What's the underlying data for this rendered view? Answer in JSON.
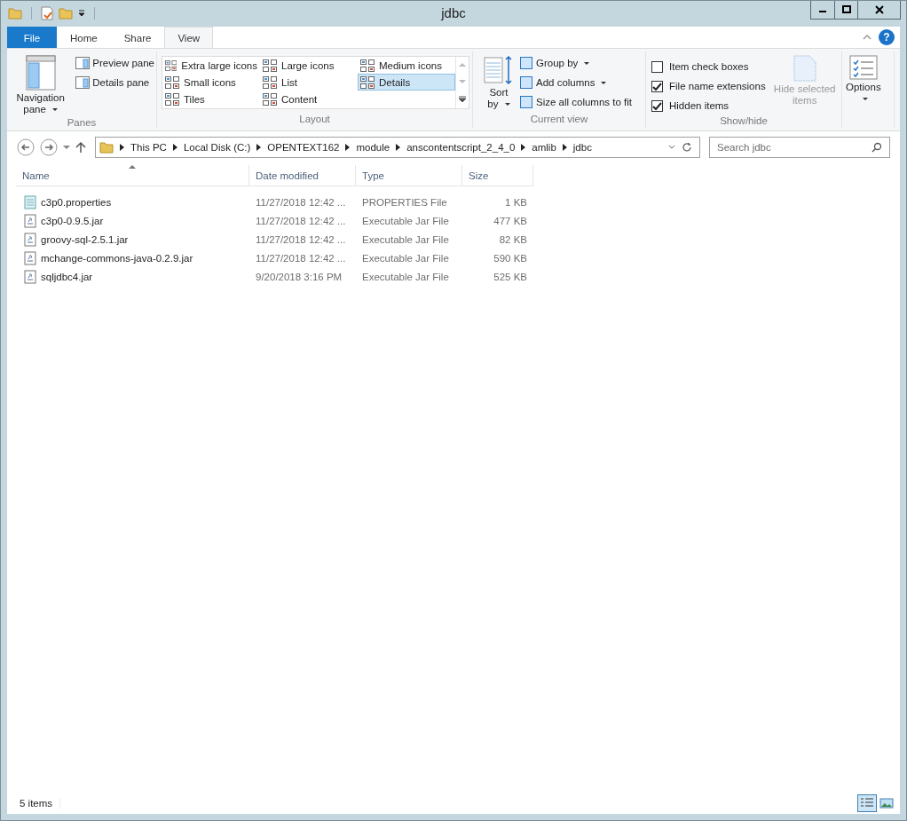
{
  "window": {
    "title": "jdbc",
    "help": "?"
  },
  "tabs": [
    {
      "label": "File",
      "kind": "file",
      "selected": false
    },
    {
      "label": "Home",
      "kind": "normal",
      "selected": false
    },
    {
      "label": "Share",
      "kind": "normal",
      "selected": false
    },
    {
      "label": "View",
      "kind": "normal",
      "selected": true
    }
  ],
  "ribbon": {
    "panes": {
      "large_button": "Navigation pane",
      "buttons": [
        "Preview pane",
        "Details pane"
      ],
      "label": "Panes"
    },
    "layout": {
      "items": [
        {
          "label": "Extra large icons",
          "selected": false
        },
        {
          "label": "Large icons",
          "selected": false
        },
        {
          "label": "Medium icons",
          "selected": false
        },
        {
          "label": "Small icons",
          "selected": false
        },
        {
          "label": "List",
          "selected": false
        },
        {
          "label": "Details",
          "selected": true
        },
        {
          "label": "Tiles",
          "selected": false
        },
        {
          "label": "Content",
          "selected": false
        }
      ],
      "label": "Layout"
    },
    "current_view": {
      "sort_button": "Sort by",
      "buttons": [
        {
          "label": "Group by",
          "dropdown": true
        },
        {
          "label": "Add columns",
          "dropdown": true
        },
        {
          "label": "Size all columns to fit",
          "dropdown": false
        }
      ],
      "label": "Current view"
    },
    "show_hide": {
      "checkboxes": [
        {
          "label": "Item check boxes",
          "checked": false
        },
        {
          "label": "File name extensions",
          "checked": true
        },
        {
          "label": "Hidden items",
          "checked": true
        }
      ],
      "hide_button": {
        "label": "Hide selected items",
        "disabled": true
      },
      "label": "Show/hide"
    },
    "options": {
      "label": "Options"
    }
  },
  "address": {
    "crumbs": [
      "This PC",
      "Local Disk (C:)",
      "OPENTEXT162",
      "module",
      "anscontentscript_2_4_0",
      "amlib",
      "jdbc"
    ]
  },
  "search": {
    "placeholder": "Search jdbc"
  },
  "table": {
    "columns": [
      {
        "label": "Name",
        "sorted": true
      },
      {
        "label": "Date modified",
        "sorted": false
      },
      {
        "label": "Type",
        "sorted": false
      },
      {
        "label": "Size",
        "sorted": false
      }
    ],
    "rows": [
      {
        "name": "c3p0.properties",
        "date": "11/27/2018 12:42 ...",
        "type": "PROPERTIES File",
        "size": "1 KB",
        "kind": "properties"
      },
      {
        "name": "c3p0-0.9.5.jar",
        "date": "11/27/2018 12:42 ...",
        "type": "Executable Jar File",
        "size": "477 KB",
        "kind": "jar"
      },
      {
        "name": "groovy-sql-2.5.1.jar",
        "date": "11/27/2018 12:42 ...",
        "type": "Executable Jar File",
        "size": "82 KB",
        "kind": "jar"
      },
      {
        "name": "mchange-commons-java-0.2.9.jar",
        "date": "11/27/2018 12:42 ...",
        "type": "Executable Jar File",
        "size": "590 KB",
        "kind": "jar"
      },
      {
        "name": "sqljdbc4.jar",
        "date": "9/20/2018 3:16 PM",
        "type": "Executable Jar File",
        "size": "525 KB",
        "kind": "jar"
      }
    ]
  },
  "status_bar": {
    "text": "5 items",
    "views": [
      {
        "kind": "details",
        "selected": true
      },
      {
        "kind": "large",
        "selected": false
      }
    ]
  }
}
